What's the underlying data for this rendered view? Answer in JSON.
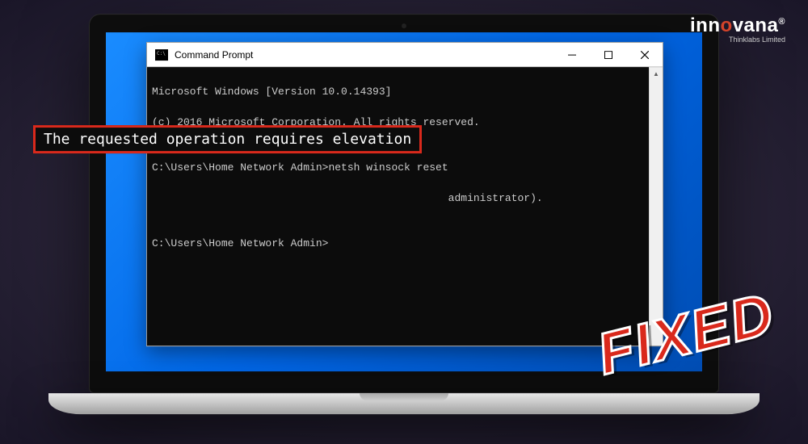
{
  "brand": {
    "name_pre": "inn",
    "name_o": "o",
    "name_post": "vana",
    "reg": "®",
    "sub": "Thinklabs Limited"
  },
  "window": {
    "title": "Command Prompt"
  },
  "terminal": {
    "line1": "Microsoft Windows [Version 10.0.14393]",
    "line2": "(c) 2016 Microsoft Corporation. All rights reserved.",
    "blank1": "",
    "line3_prompt": "C:\\Users\\Home Network Admin>",
    "line3_cmd": "netsh winsock reset",
    "line4_tail": "administrator).",
    "blank2": "",
    "line5_prompt": "C:\\Users\\Home Network Admin>"
  },
  "highlight": {
    "text": "The requested operation requires elevation"
  },
  "stamp": {
    "text": "FIXED"
  }
}
